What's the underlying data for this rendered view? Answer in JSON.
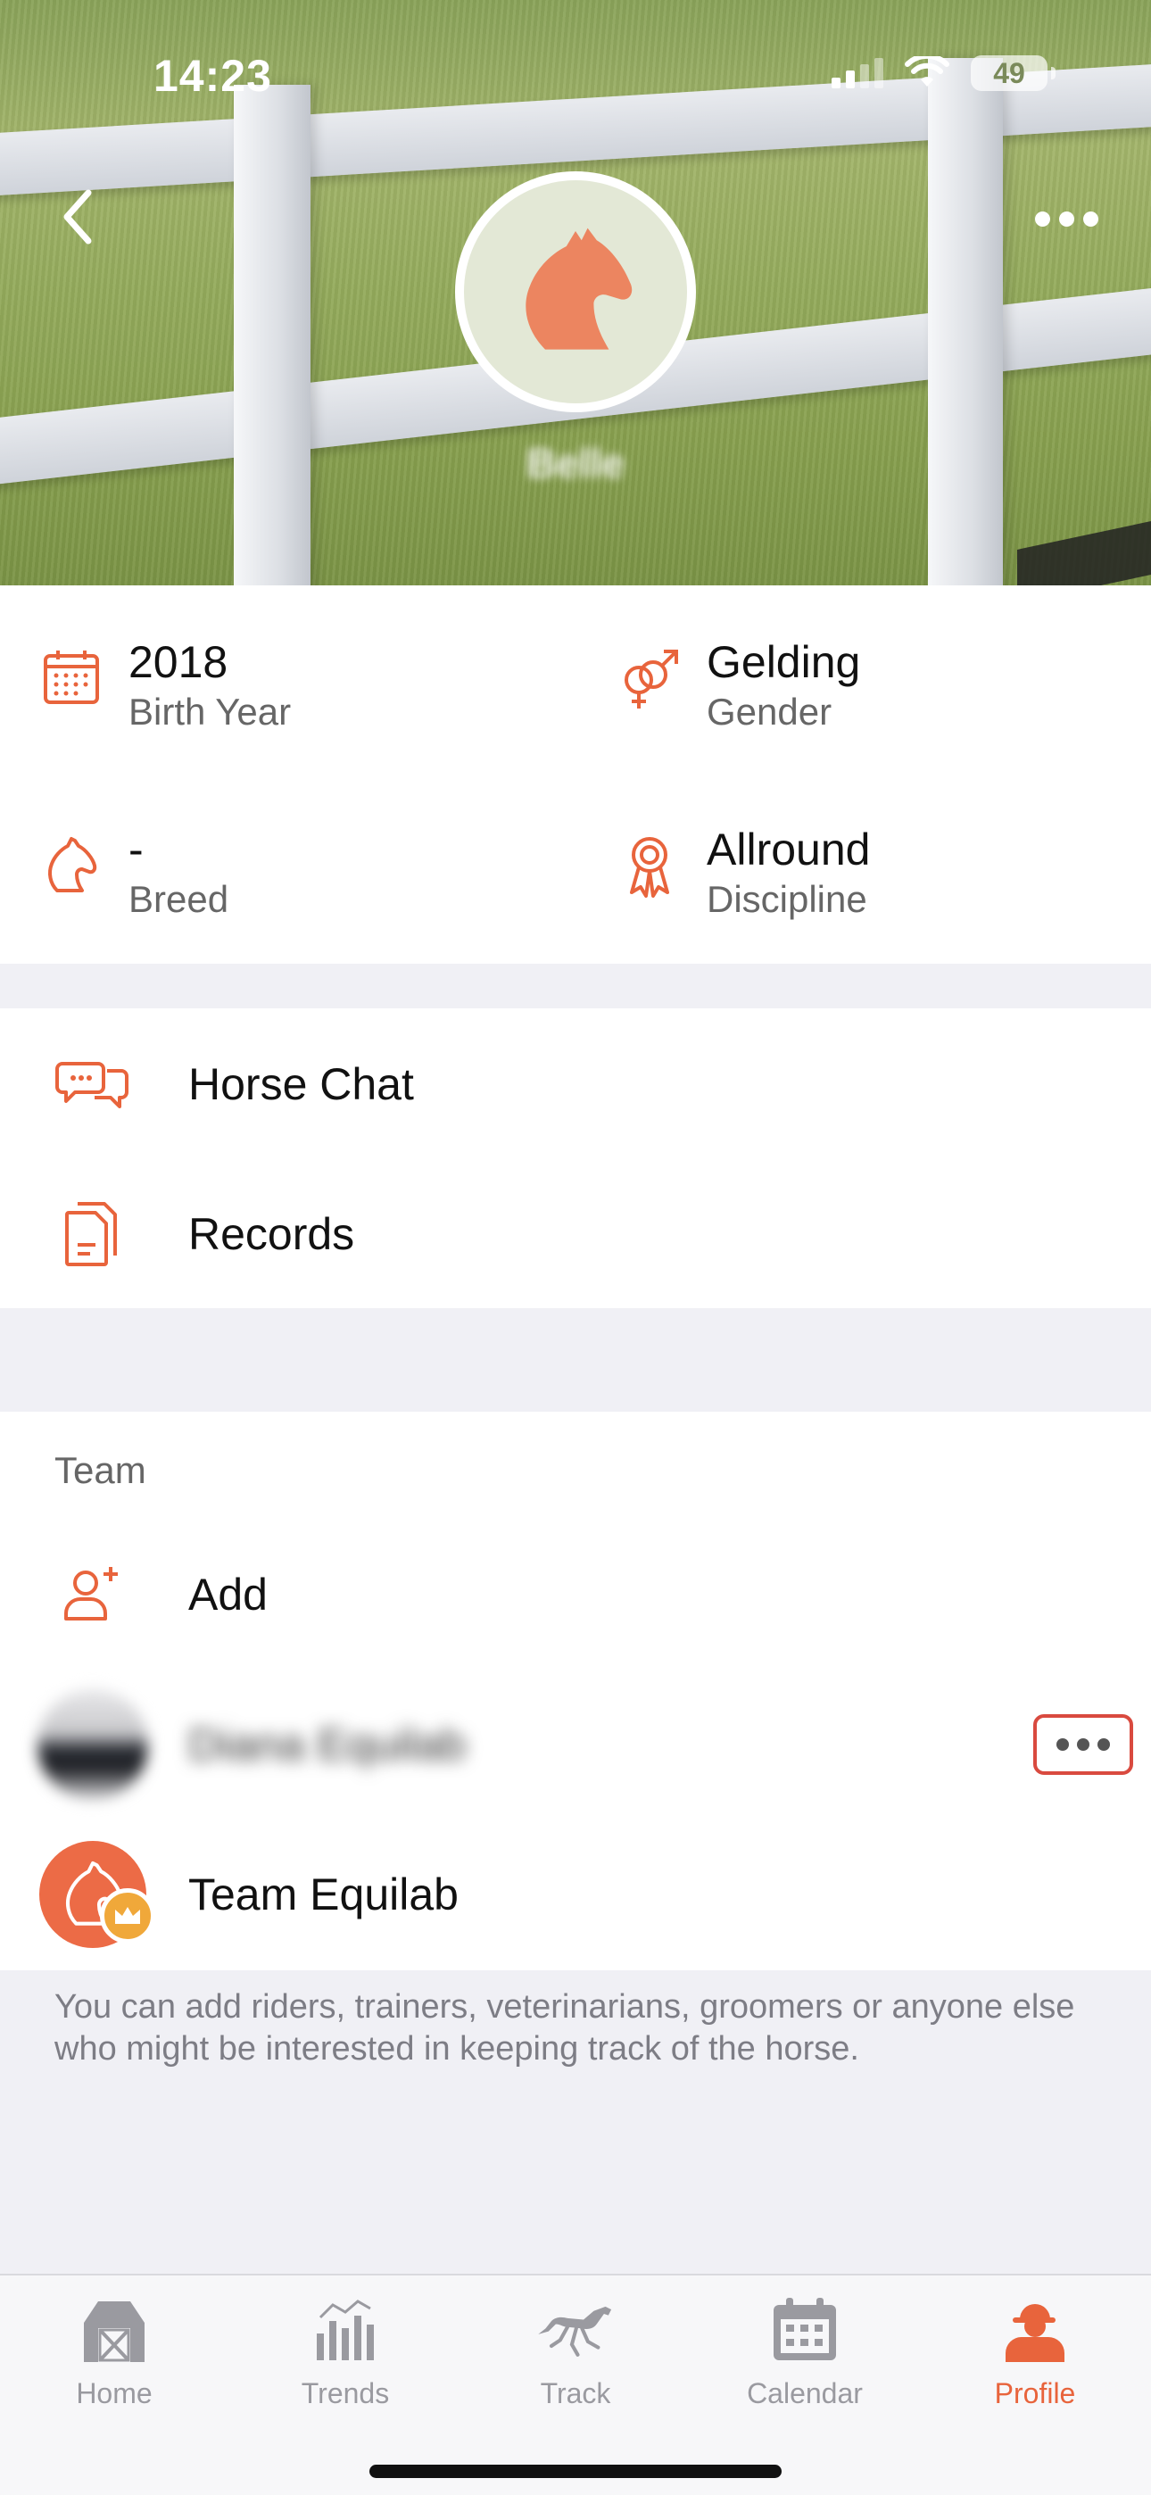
{
  "status_bar": {
    "time": "14:23",
    "battery": "49"
  },
  "header": {
    "horse_name": "Belle"
  },
  "info": [
    {
      "value": "2018",
      "label": "Birth Year",
      "icon": "calendar-icon"
    },
    {
      "value": "Gelding",
      "label": "Gender",
      "icon": "gender-icon"
    },
    {
      "value": "-",
      "label": "Breed",
      "icon": "horse-head-icon"
    },
    {
      "value": "Allround",
      "label": "Discipline",
      "icon": "ribbon-icon"
    }
  ],
  "menu": {
    "horse_chat": "Horse Chat",
    "records": "Records"
  },
  "team": {
    "header": "Team",
    "add_label": "Add",
    "members": [
      {
        "name": "Diana Equilab"
      },
      {
        "name": "Team Equilab"
      }
    ],
    "note": "You can add riders, trainers, veterinarians, groomers or anyone else who might be interested in keeping track of the horse."
  },
  "tabs": [
    {
      "label": "Home",
      "icon": "barn-icon"
    },
    {
      "label": "Trends",
      "icon": "bar-chart-icon"
    },
    {
      "label": "Track",
      "icon": "running-horse-icon"
    },
    {
      "label": "Calendar",
      "icon": "calendar-icon"
    },
    {
      "label": "Profile",
      "icon": "rider-profile-icon",
      "active": true
    }
  ],
  "colors": {
    "accent": "#e8643c",
    "background": "#f0f0f5"
  }
}
